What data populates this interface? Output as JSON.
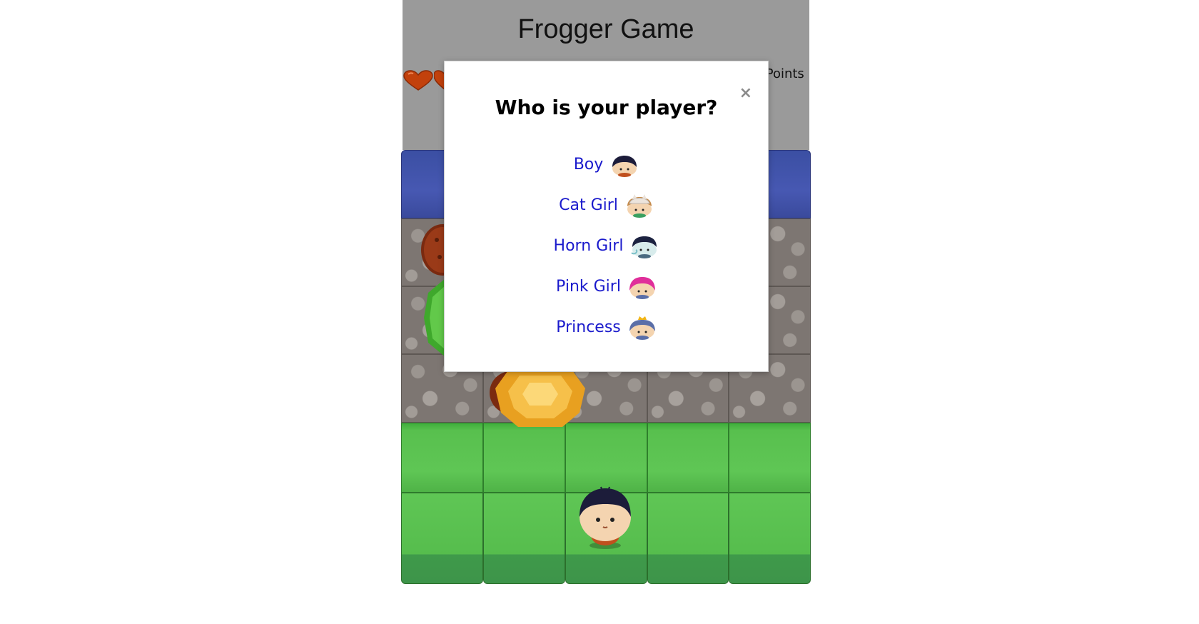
{
  "game": {
    "title": "Frogger Game",
    "score_text": ") Points",
    "lives": 2
  },
  "modal": {
    "title": "Who is your player?",
    "close_symbol": "×",
    "options": [
      {
        "label": "Boy",
        "icon": "boy-icon",
        "hair": "#1c1c3a",
        "accent": "#c0501e"
      },
      {
        "label": "Cat Girl",
        "icon": "cat-girl-icon",
        "hair": "#e8e0d8",
        "accent": "#c58a4a"
      },
      {
        "label": "Horn Girl",
        "icon": "horn-girl-icon",
        "hair": "#1c2240",
        "accent": "#7ac0c8"
      },
      {
        "label": "Pink Girl",
        "icon": "pink-girl-icon",
        "hair": "#e02e9a",
        "accent": "#e02e9a"
      },
      {
        "label": "Princess",
        "icon": "princess-icon",
        "hair": "#5a6ea8",
        "accent": "#f2b516"
      }
    ]
  },
  "colors": {
    "header_bg": "#9a9a9a",
    "link": "#1a1acc",
    "water": "#4758b2",
    "grass": "#5fc655",
    "heart": "#c2410c"
  }
}
